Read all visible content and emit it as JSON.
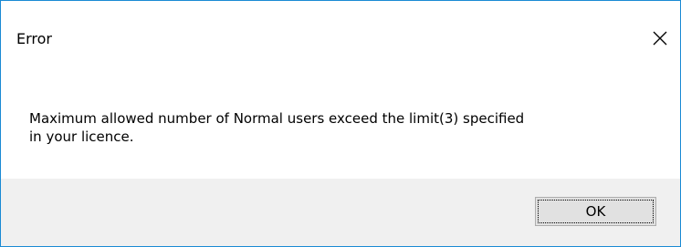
{
  "dialog": {
    "title": "Error",
    "close_icon": "close-icon",
    "message_line1": "Maximum allowed number of Normal users exceed the limit(3) specified",
    "message_line2": "in your licence.",
    "ok_label": "OK"
  },
  "colors": {
    "border": "#1a8ad4",
    "footer_background": "#f0f0f0",
    "button_background": "#e1e1e1",
    "button_border": "#adadad"
  }
}
